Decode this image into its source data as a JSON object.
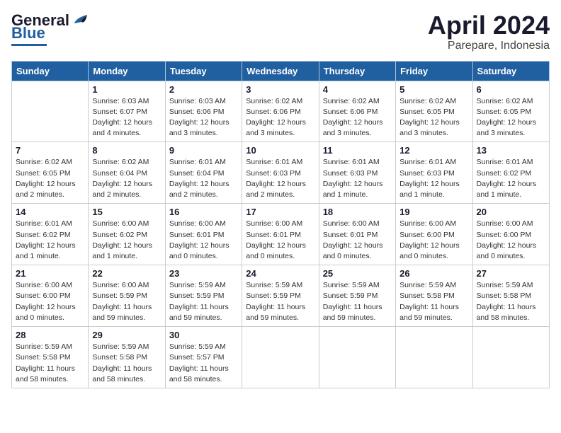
{
  "header": {
    "logo_general": "General",
    "logo_blue": "Blue",
    "month_title": "April 2024",
    "location": "Parepare, Indonesia"
  },
  "days_of_week": [
    "Sunday",
    "Monday",
    "Tuesday",
    "Wednesday",
    "Thursday",
    "Friday",
    "Saturday"
  ],
  "weeks": [
    [
      {
        "num": "",
        "info": ""
      },
      {
        "num": "1",
        "info": "Sunrise: 6:03 AM\nSunset: 6:07 PM\nDaylight: 12 hours\nand 4 minutes."
      },
      {
        "num": "2",
        "info": "Sunrise: 6:03 AM\nSunset: 6:06 PM\nDaylight: 12 hours\nand 3 minutes."
      },
      {
        "num": "3",
        "info": "Sunrise: 6:02 AM\nSunset: 6:06 PM\nDaylight: 12 hours\nand 3 minutes."
      },
      {
        "num": "4",
        "info": "Sunrise: 6:02 AM\nSunset: 6:06 PM\nDaylight: 12 hours\nand 3 minutes."
      },
      {
        "num": "5",
        "info": "Sunrise: 6:02 AM\nSunset: 6:05 PM\nDaylight: 12 hours\nand 3 minutes."
      },
      {
        "num": "6",
        "info": "Sunrise: 6:02 AM\nSunset: 6:05 PM\nDaylight: 12 hours\nand 3 minutes."
      }
    ],
    [
      {
        "num": "7",
        "info": "Sunrise: 6:02 AM\nSunset: 6:05 PM\nDaylight: 12 hours\nand 2 minutes."
      },
      {
        "num": "8",
        "info": "Sunrise: 6:02 AM\nSunset: 6:04 PM\nDaylight: 12 hours\nand 2 minutes."
      },
      {
        "num": "9",
        "info": "Sunrise: 6:01 AM\nSunset: 6:04 PM\nDaylight: 12 hours\nand 2 minutes."
      },
      {
        "num": "10",
        "info": "Sunrise: 6:01 AM\nSunset: 6:03 PM\nDaylight: 12 hours\nand 2 minutes."
      },
      {
        "num": "11",
        "info": "Sunrise: 6:01 AM\nSunset: 6:03 PM\nDaylight: 12 hours\nand 1 minute."
      },
      {
        "num": "12",
        "info": "Sunrise: 6:01 AM\nSunset: 6:03 PM\nDaylight: 12 hours\nand 1 minute."
      },
      {
        "num": "13",
        "info": "Sunrise: 6:01 AM\nSunset: 6:02 PM\nDaylight: 12 hours\nand 1 minute."
      }
    ],
    [
      {
        "num": "14",
        "info": "Sunrise: 6:01 AM\nSunset: 6:02 PM\nDaylight: 12 hours\nand 1 minute."
      },
      {
        "num": "15",
        "info": "Sunrise: 6:00 AM\nSunset: 6:02 PM\nDaylight: 12 hours\nand 1 minute."
      },
      {
        "num": "16",
        "info": "Sunrise: 6:00 AM\nSunset: 6:01 PM\nDaylight: 12 hours\nand 0 minutes."
      },
      {
        "num": "17",
        "info": "Sunrise: 6:00 AM\nSunset: 6:01 PM\nDaylight: 12 hours\nand 0 minutes."
      },
      {
        "num": "18",
        "info": "Sunrise: 6:00 AM\nSunset: 6:01 PM\nDaylight: 12 hours\nand 0 minutes."
      },
      {
        "num": "19",
        "info": "Sunrise: 6:00 AM\nSunset: 6:00 PM\nDaylight: 12 hours\nand 0 minutes."
      },
      {
        "num": "20",
        "info": "Sunrise: 6:00 AM\nSunset: 6:00 PM\nDaylight: 12 hours\nand 0 minutes."
      }
    ],
    [
      {
        "num": "21",
        "info": "Sunrise: 6:00 AM\nSunset: 6:00 PM\nDaylight: 12 hours\nand 0 minutes."
      },
      {
        "num": "22",
        "info": "Sunrise: 6:00 AM\nSunset: 5:59 PM\nDaylight: 11 hours\nand 59 minutes."
      },
      {
        "num": "23",
        "info": "Sunrise: 5:59 AM\nSunset: 5:59 PM\nDaylight: 11 hours\nand 59 minutes."
      },
      {
        "num": "24",
        "info": "Sunrise: 5:59 AM\nSunset: 5:59 PM\nDaylight: 11 hours\nand 59 minutes."
      },
      {
        "num": "25",
        "info": "Sunrise: 5:59 AM\nSunset: 5:59 PM\nDaylight: 11 hours\nand 59 minutes."
      },
      {
        "num": "26",
        "info": "Sunrise: 5:59 AM\nSunset: 5:58 PM\nDaylight: 11 hours\nand 59 minutes."
      },
      {
        "num": "27",
        "info": "Sunrise: 5:59 AM\nSunset: 5:58 PM\nDaylight: 11 hours\nand 58 minutes."
      }
    ],
    [
      {
        "num": "28",
        "info": "Sunrise: 5:59 AM\nSunset: 5:58 PM\nDaylight: 11 hours\nand 58 minutes."
      },
      {
        "num": "29",
        "info": "Sunrise: 5:59 AM\nSunset: 5:58 PM\nDaylight: 11 hours\nand 58 minutes."
      },
      {
        "num": "30",
        "info": "Sunrise: 5:59 AM\nSunset: 5:57 PM\nDaylight: 11 hours\nand 58 minutes."
      },
      {
        "num": "",
        "info": ""
      },
      {
        "num": "",
        "info": ""
      },
      {
        "num": "",
        "info": ""
      },
      {
        "num": "",
        "info": ""
      }
    ]
  ]
}
